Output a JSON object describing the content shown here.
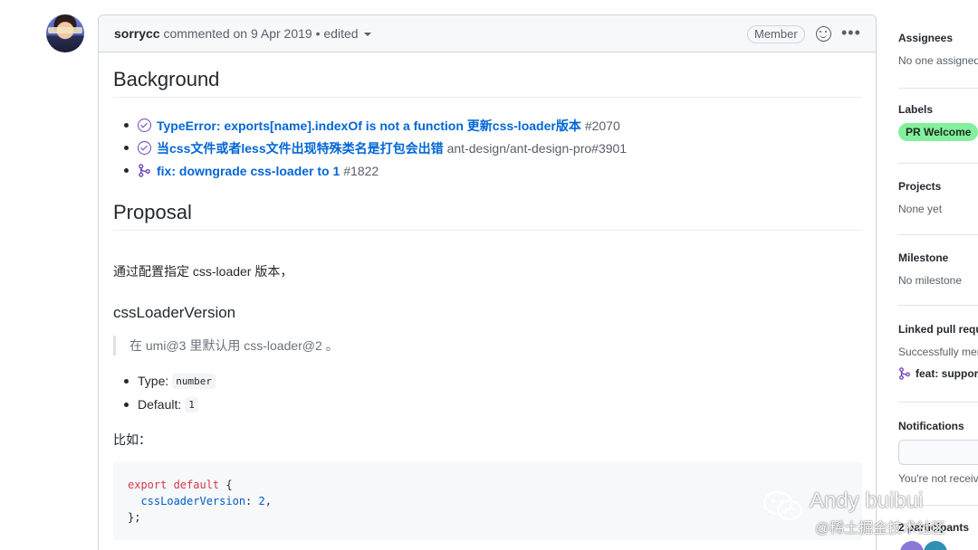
{
  "comment": {
    "author": "sorrycc",
    "meta": "commented on 9 Apr 2019 • edited",
    "badge": "Member",
    "emoji_icon": "smiley-icon",
    "more_icon": "kebab-icon"
  },
  "body": {
    "background_heading": "Background",
    "refs": [
      {
        "icon": "issue-closed-icon",
        "title": "TypeError: exports[name].indexOf is not a function 更新css-loader版本",
        "num": "#2070"
      },
      {
        "icon": "issue-closed-icon",
        "title": "当css文件或者less文件出现特殊类名是打包会出错",
        "num": "ant-design/ant-design-pro#3901"
      },
      {
        "icon": "git-merge-icon",
        "title": "fix: downgrade css-loader to 1",
        "num": "#1822"
      }
    ],
    "proposal_heading": "Proposal",
    "intro": "通过配置指定 css-loader 版本，",
    "option_heading": "cssLoaderVersion",
    "quote": "在 umi@3 里默认用 css-loader@2 。",
    "props": [
      {
        "label": "Type:",
        "code": "number"
      },
      {
        "label": "Default:",
        "code": "1"
      }
    ],
    "example_label": "比如：",
    "code": {
      "line1_kw": "export default",
      "line1_rest": " {",
      "line2_key": "  cssLoaderVersion",
      "line2_colon": ": ",
      "line2_val": "2",
      "line2_end": ",",
      "line3": "};"
    }
  },
  "sidebar": {
    "assignees_head": "Assignees",
    "assignees_val": "No one assigned",
    "labels_head": "Labels",
    "label_pill": "PR Welcome",
    "label_color": "#84f09e",
    "projects_head": "Projects",
    "projects_val": "None yet",
    "milestone_head": "Milestone",
    "milestone_val": "No milestone",
    "linked_head": "Linked pull requests",
    "linked_val": "Successfully merging",
    "linked_pr": "feat: support",
    "notifications_head": "Notifications",
    "notifications_val": "You're not receiving",
    "participants_head": "2 participants"
  },
  "watermark": {
    "title": "Andy buibui",
    "sub": "@稀土掘金技术社区"
  }
}
